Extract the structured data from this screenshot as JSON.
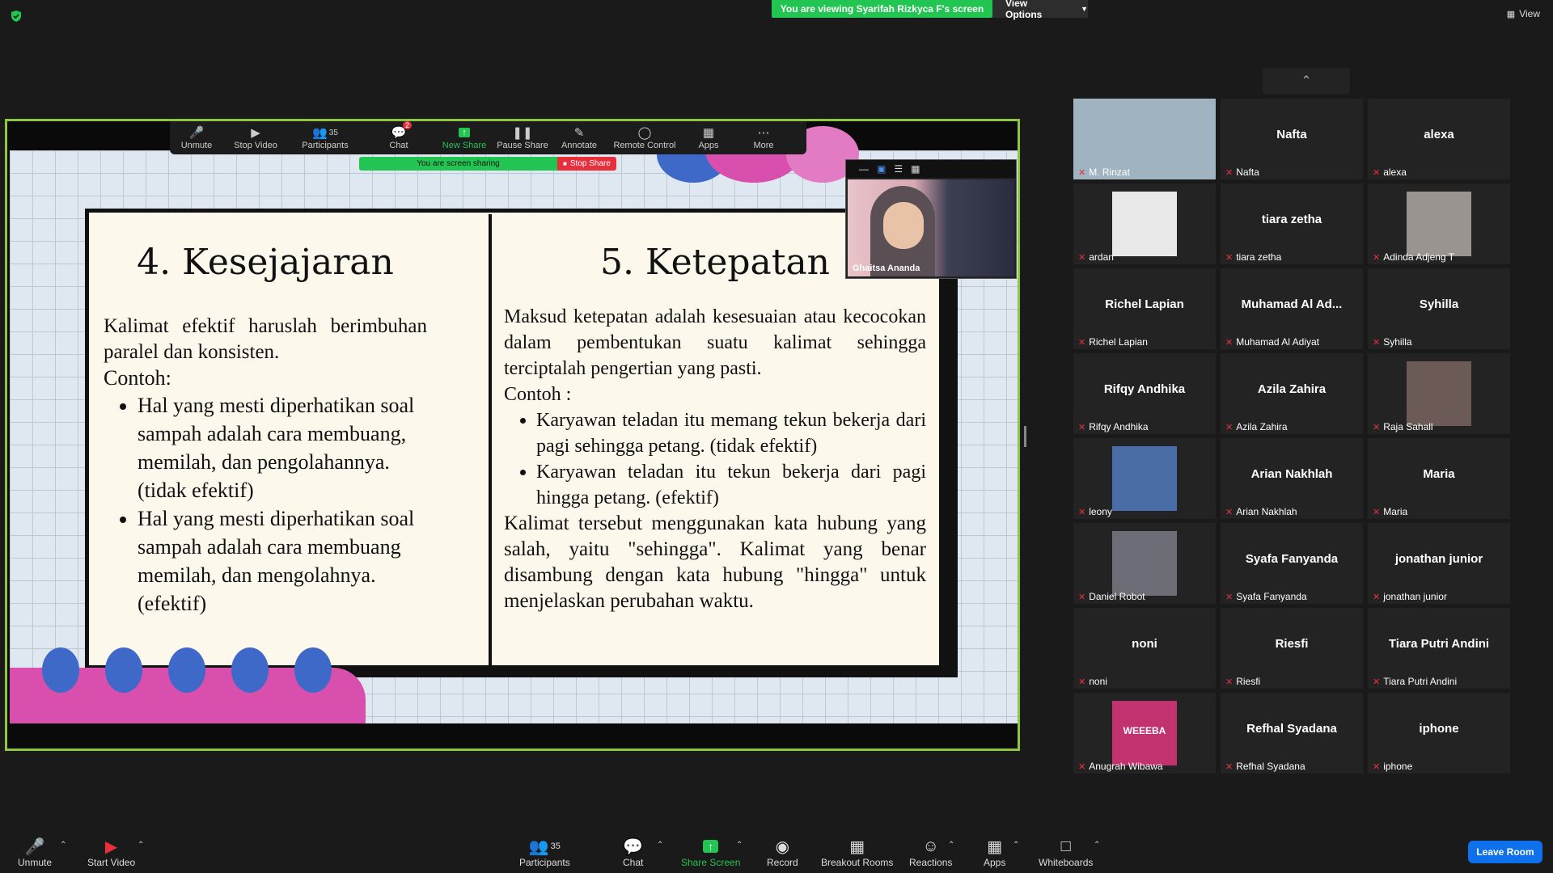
{
  "top": {
    "viewing_banner": "You are viewing Syarifah Rizkyca F's screen",
    "view_options": "View Options",
    "view": "View"
  },
  "host_toolbar": {
    "unmute": "Unmute",
    "stop_video": "Stop Video",
    "participants": "Participants",
    "participants_count": "35",
    "chat": "Chat",
    "chat_badge": "2",
    "new_share": "New Share",
    "pause_share": "Pause Share",
    "annotate": "Annotate",
    "remote_control": "Remote Control",
    "apps": "Apps",
    "more": "More",
    "sharing_status": "You are screen sharing",
    "stop_share": "Stop Share"
  },
  "slide": {
    "left_heading": "4. Kesejajaran",
    "left_intro": "Kalimat efektif haruslah berimbuhan paralel dan konsisten.",
    "left_example": "Contoh:",
    "left_bullets": [
      "Hal yang mesti diperhatikan soal sampah adalah cara membuang, memilah, dan pengolahannya.(tidak efektif)",
      "Hal yang mesti diperhatikan soal sampah adalah cara membuang memilah, dan mengolahnya. (efektif)"
    ],
    "right_heading": "5. Ketepatan",
    "right_intro": "Maksud ketepatan adalah kesesuaian atau kecocokan dalam pembentukan suatu kalimat sehingga terciptalah pengertian yang pasti.",
    "right_example": "Contoh :",
    "right_bullets": [
      "Karyawan teladan itu memang tekun bekerja dari pagi sehingga petang. (tidak efektif)",
      "Karyawan teladan itu tekun bekerja dari pagi hingga petang. (efektif)"
    ],
    "right_outro": "Kalimat tersebut menggunakan kata hubung yang salah, yaitu \"sehingga\". Kalimat yang benar disambung dengan kata hubung \"hingga\" untuk menjelaskan perubahan waktu."
  },
  "floating_video": {
    "name": "Ghaitsa Ananda"
  },
  "gallery": [
    {
      "label": "M. Rinzat",
      "big": "",
      "thumb": "video",
      "thumb_color": "#9fb4c0"
    },
    {
      "label": "Nafta",
      "big": "Nafta"
    },
    {
      "label": "alexa",
      "big": "alexa"
    },
    {
      "label": "ardan",
      "big": "",
      "thumb": "image",
      "thumb_color": "#e8e8e8"
    },
    {
      "label": "tiara zetha",
      "big": "tiara zetha"
    },
    {
      "label": "Adinda Adjeng T",
      "big": "",
      "thumb": "image",
      "thumb_color": "#9a9490"
    },
    {
      "label": "Richel Lapian",
      "big": "Richel Lapian"
    },
    {
      "label": "Muhamad Al Adiyat",
      "big": "Muhamad Al Ad..."
    },
    {
      "label": "Syhilla",
      "big": "Syhilla"
    },
    {
      "label": "Rifqy Andhika",
      "big": "Rifqy Andhika"
    },
    {
      "label": "Azila Zahira",
      "big": "Azila Zahira"
    },
    {
      "label": "Raja Sahall",
      "big": "",
      "thumb": "image",
      "thumb_color": "#6b5a56"
    },
    {
      "label": "leony",
      "big": "",
      "thumb": "image",
      "thumb_color": "#4a6da8"
    },
    {
      "label": "Arian Nakhlah",
      "big": "Arian Nakhlah"
    },
    {
      "label": "Maria",
      "big": "Maria"
    },
    {
      "label": "Daniel Robot",
      "big": "",
      "thumb": "image",
      "thumb_color": "#6d6d78"
    },
    {
      "label": "Syafa Fanyanda",
      "big": "Syafa Fanyanda"
    },
    {
      "label": "jonathan junior",
      "big": "jonathan junior"
    },
    {
      "label": "noni",
      "big": "noni"
    },
    {
      "label": "Riesfi",
      "big": "Riesfi"
    },
    {
      "label": "Tiara Putri Andini",
      "big": "Tiara Putri Andini"
    },
    {
      "label": "Anugrah Wibawa",
      "big": "",
      "thumb": "image",
      "thumb_color": "#c2326f",
      "thumb_text": "WEEEBA"
    },
    {
      "label": "Refhal Syadana",
      "big": "Refhal Syadana"
    },
    {
      "label": "iphone",
      "big": "iphone"
    }
  ],
  "bottom_bar": {
    "unmute": "Unmute",
    "start_video": "Start Video",
    "participants": "Participants",
    "participants_count": "35",
    "chat": "Chat",
    "share_screen": "Share Screen",
    "record": "Record",
    "breakout_rooms": "Breakout Rooms",
    "reactions": "Reactions",
    "apps": "Apps",
    "whiteboards": "Whiteboards",
    "leave_room": "Leave Room"
  },
  "colors": {
    "accent_green": "#23c552",
    "share_border": "#8ec63f",
    "stop_red": "#e8303c",
    "leave_blue": "#0e71eb"
  }
}
